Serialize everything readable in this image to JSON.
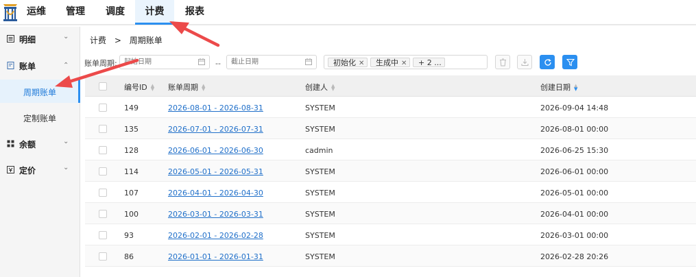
{
  "nav": {
    "tabs": [
      {
        "label": "运维"
      },
      {
        "label": "管理"
      },
      {
        "label": "调度"
      },
      {
        "label": "计费"
      },
      {
        "label": "报表"
      }
    ]
  },
  "sidebar": {
    "groups": [
      {
        "label": "明细",
        "icon": "list-icon"
      },
      {
        "label": "账单",
        "icon": "bill-icon"
      },
      {
        "label": "余额",
        "icon": "grid-icon"
      },
      {
        "label": "定价",
        "icon": "price-icon"
      }
    ],
    "subitems": [
      {
        "label": "周期账单"
      },
      {
        "label": "定制账单"
      }
    ]
  },
  "breadcrumb": {
    "parent": "计费",
    "separator": ">",
    "current": "周期账单"
  },
  "filter": {
    "label": "账单周期:",
    "start_placeholder": "起始日期",
    "range_dash": "--",
    "end_placeholder": "截止日期",
    "tags": [
      "初始化",
      "生成中"
    ],
    "more": "+ 2 ..."
  },
  "table": {
    "columns": [
      "编号ID",
      "账单周期",
      "创建人",
      "创建日期"
    ],
    "rows": [
      {
        "id": "149",
        "period": "2026-08-01 - 2026-08-31",
        "creator": "SYSTEM",
        "created": "2026-09-04 14:48"
      },
      {
        "id": "135",
        "period": "2026-07-01 - 2026-07-31",
        "creator": "SYSTEM",
        "created": "2026-08-01 00:00"
      },
      {
        "id": "128",
        "period": "2026-06-01 - 2026-06-30",
        "creator": "cadmin",
        "created": "2026-06-25 15:30"
      },
      {
        "id": "114",
        "period": "2026-05-01 - 2026-05-31",
        "creator": "SYSTEM",
        "created": "2026-06-01 00:00"
      },
      {
        "id": "107",
        "period": "2026-04-01 - 2026-04-30",
        "creator": "SYSTEM",
        "created": "2026-05-01 00:00"
      },
      {
        "id": "100",
        "period": "2026-03-01 - 2026-03-31",
        "creator": "SYSTEM",
        "created": "2026-04-01 00:00"
      },
      {
        "id": "93",
        "period": "2026-02-01 - 2026-02-28",
        "creator": "SYSTEM",
        "created": "2026-03-01 00:00"
      },
      {
        "id": "86",
        "period": "2026-01-01 - 2026-01-31",
        "creator": "SYSTEM",
        "created": "2026-02-28 20:26"
      }
    ]
  },
  "colors": {
    "accent": "#2b8ff0",
    "link": "#1f6fc9",
    "annotation": "#ec4a4a"
  }
}
